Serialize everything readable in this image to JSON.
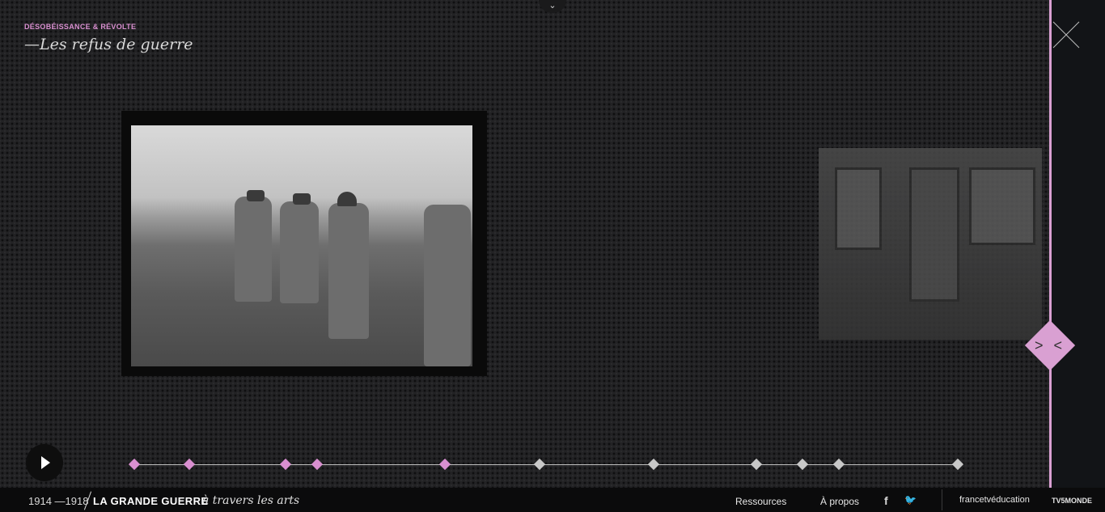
{
  "header": {
    "kicker": "DÉSOBÉISSANCE & RÉVOLTE",
    "title": "—Les refus de guerre",
    "top_handle_icon": "chevron-down-icon"
  },
  "controls": {
    "close_icon": "close-icon",
    "nav_icon": "prev-next-arrows-icon",
    "nav_label": "> <",
    "play_icon": "play-icon"
  },
  "timeline": {
    "markers": [
      {
        "state": "visited"
      },
      {
        "state": "visited"
      },
      {
        "state": "visited"
      },
      {
        "state": "visited"
      },
      {
        "state": "visited"
      },
      {
        "state": "unvisited"
      },
      {
        "state": "unvisited"
      },
      {
        "state": "unvisited"
      },
      {
        "state": "unvisited"
      },
      {
        "state": "unvisited"
      },
      {
        "state": "unvisited"
      }
    ]
  },
  "footer": {
    "years": "1914 —1918",
    "brand": "LA GRANDE GUERRE",
    "brand_sub": "à travers les arts",
    "links": [
      "Ressources",
      "À propos"
    ],
    "social": {
      "facebook": "f",
      "twitter": "🐦"
    },
    "partners": [
      "francetvéducation",
      "TV5MONDE"
    ]
  },
  "colors": {
    "accent": "#d98fd0",
    "accent_line": "#d9a0d2",
    "background": "#222224",
    "footer": "#0b0b0c"
  }
}
